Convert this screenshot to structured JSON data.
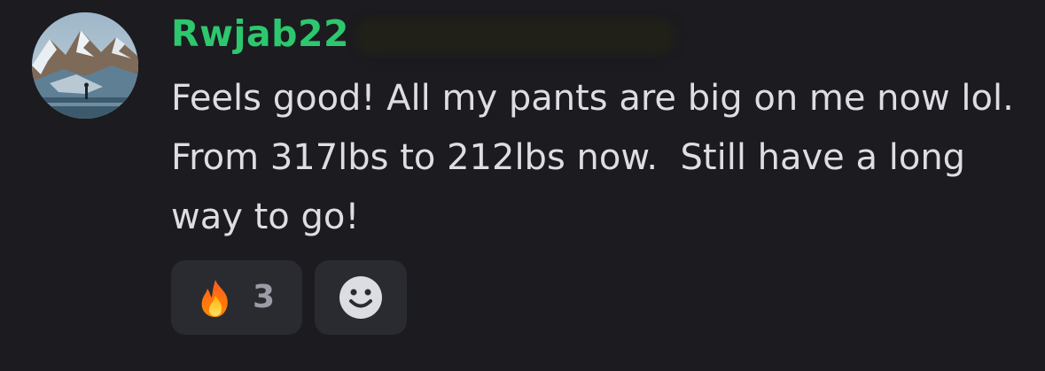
{
  "message": {
    "author": "Rwjab22",
    "author_color": "#2dc76d",
    "text": "Feels good! All my pants are big on me now lol. From 317lbs to 212lbs now.  Still have a long way to go!",
    "avatar_icon": "mountain-landscape-avatar"
  },
  "reactions": [
    {
      "emoji": "🔥",
      "icon": "fire-icon",
      "count": "3"
    }
  ],
  "add_reaction": {
    "icon": "smiley-add-reaction-icon"
  }
}
